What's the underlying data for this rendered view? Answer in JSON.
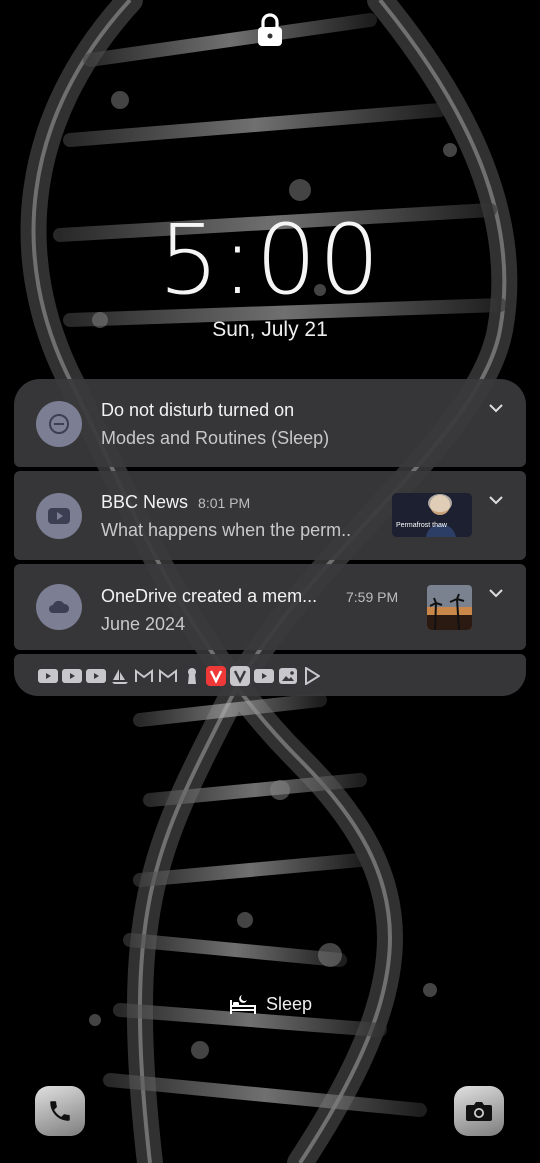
{
  "clock": {
    "time": "5:00",
    "date": "Sun, July 21"
  },
  "notifications": [
    {
      "app": "dnd",
      "icon": "dnd-icon",
      "title": "Do not disturb turned on",
      "time": "",
      "body": "Modes and Routines (Sleep)"
    },
    {
      "app": "youtube",
      "icon": "youtube-icon",
      "title": "BBC News",
      "time": "8:01 PM",
      "body": "What happens when the perm..",
      "thumbnail_caption": "Permafrost thaw"
    },
    {
      "app": "onedrive",
      "icon": "cloud-icon",
      "title": "OneDrive created a mem...",
      "time": "7:59 PM",
      "body": "June 2024"
    }
  ],
  "notification_icons": [
    "youtube-icon",
    "youtube-icon",
    "youtube-icon",
    "sailboat-icon",
    "gmail-icon",
    "gmail-icon",
    "keyhole-icon",
    "vivaldi-icon",
    "vivaldi-icon",
    "youtube-icon",
    "gallery-icon",
    "play-store-icon"
  ],
  "mode": {
    "label": "Sleep",
    "icon": "bed-icon"
  },
  "shortcuts": {
    "left": "phone-icon",
    "right": "camera-icon"
  },
  "colors": {
    "card": "#3a3a3c",
    "app_circle": "#7c7f94",
    "vivaldi": "#ef3939"
  }
}
